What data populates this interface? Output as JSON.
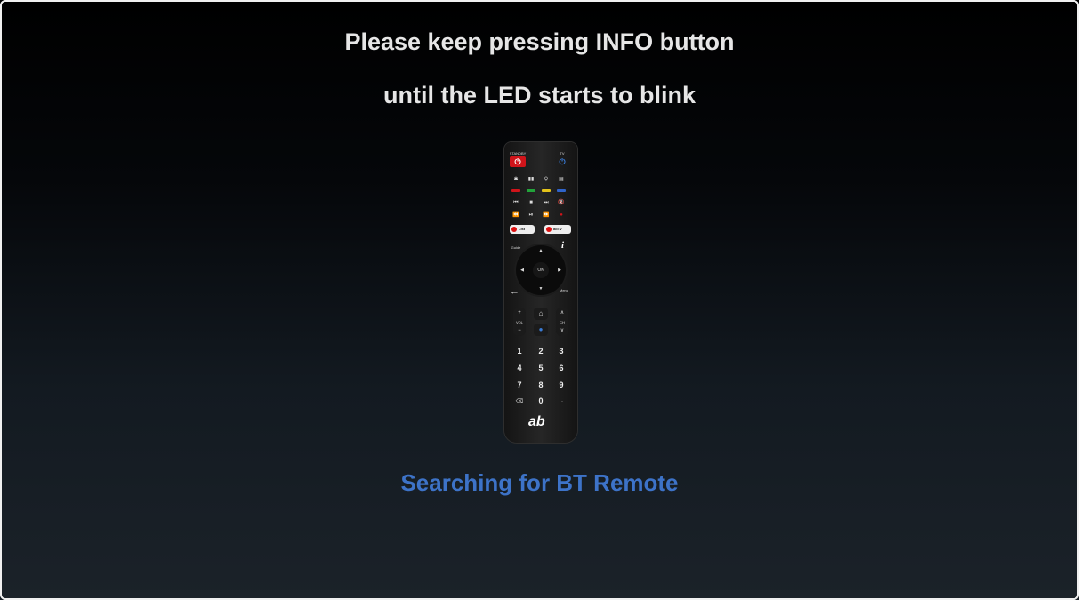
{
  "instructions": {
    "line1": "Please keep pressing INFO button",
    "line2": "until the LED starts to blink"
  },
  "status": {
    "text": "Searching for BT Remote",
    "color": "#3d73c8"
  },
  "remote": {
    "standby_label": "STANDBY",
    "tv_label": "TV",
    "power_icon": "⏻",
    "standby_color": "#d0141a",
    "tv_power_color": "#3a7bd5",
    "color_keys": [
      "#d0141a",
      "#22a33a",
      "#e3c21a",
      "#2f63c9"
    ],
    "list_label": "List",
    "abtv_label": "abTV",
    "guide_label": "Guide",
    "info_label": "i",
    "ok_label": "OK",
    "menu_label": "Menu",
    "vol_label": "VOL",
    "ch_label": "CH",
    "plus": "+",
    "minus": "−",
    "keys": [
      [
        "1",
        "2",
        "3"
      ],
      [
        "4",
        "5",
        "6"
      ],
      [
        "7",
        "8",
        "9"
      ],
      [
        "",
        "0",
        ""
      ]
    ],
    "logo": "ab"
  }
}
